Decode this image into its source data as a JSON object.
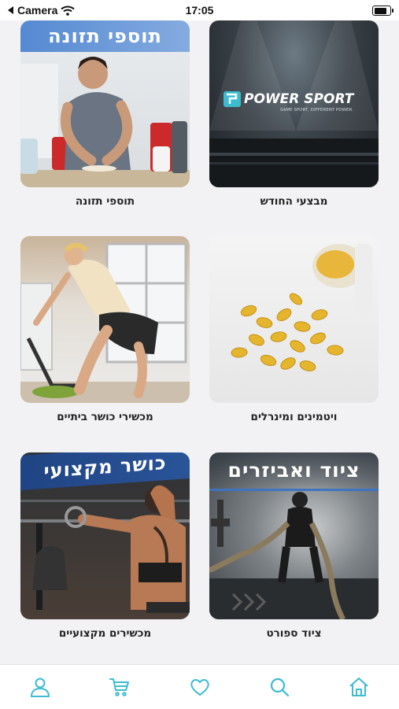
{
  "status_bar": {
    "back_label": "Camera",
    "time": "17:05"
  },
  "colors": {
    "accent": "#3bbccf",
    "background": "#f2f2f4"
  },
  "categories": [
    {
      "caption": "מבצעי החודש",
      "banner": "",
      "logo_text": "POWER SPORT",
      "logo_tagline": "SAME SPORT, DIFFERENT POWER."
    },
    {
      "caption": "תוספי תזונה",
      "banner": "תוספי תזונה"
    },
    {
      "caption": "ויטמינים ומינרלים",
      "banner": ""
    },
    {
      "caption": "מכשירי כושר ביתיים",
      "banner": ""
    },
    {
      "caption": "ציוד ספורט",
      "banner": "ציוד ואביזרים"
    },
    {
      "caption": "מכשירים מקצועיים",
      "banner": "כושר מקצועי"
    }
  ],
  "tab_bar": {
    "items": [
      {
        "icon": "home-icon"
      },
      {
        "icon": "search-icon"
      },
      {
        "icon": "heart-icon"
      },
      {
        "icon": "cart-icon"
      },
      {
        "icon": "user-icon"
      }
    ]
  }
}
